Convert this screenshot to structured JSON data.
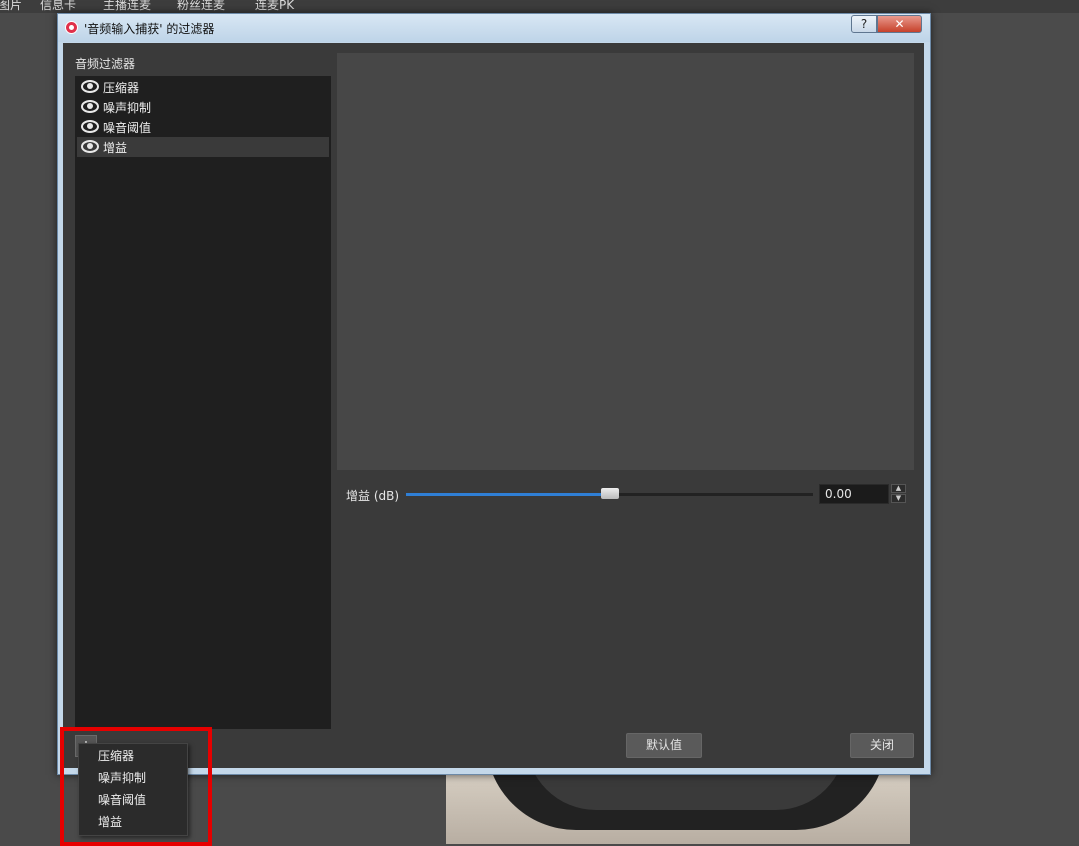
{
  "top_menu": {
    "items": [
      "图片",
      "信息卡",
      "主播连麦",
      "粉丝连麦",
      "连麦PK"
    ]
  },
  "window": {
    "title": "'音频输入捕获' 的过滤器",
    "help_label": "?",
    "close_label": "✕"
  },
  "filters_panel": {
    "label": "音频过滤器",
    "items": [
      {
        "label": "压缩器",
        "visible": true
      },
      {
        "label": "噪声抑制",
        "visible": true
      },
      {
        "label": "噪音阈值",
        "visible": true
      },
      {
        "label": "增益",
        "visible": true,
        "selected": true
      }
    ],
    "add_button_label": "+"
  },
  "gain_control": {
    "label": "增益 (dB)",
    "value": "0.00",
    "slider_fraction": 0.5
  },
  "buttons": {
    "defaults_label": "默认值",
    "close_label": "关闭"
  },
  "add_menu": {
    "items": [
      "压缩器",
      "噪声抑制",
      "噪音阈值",
      "增益"
    ]
  },
  "colors": {
    "highlight": "#e60000",
    "slider_accent": "#2f7fd6"
  }
}
